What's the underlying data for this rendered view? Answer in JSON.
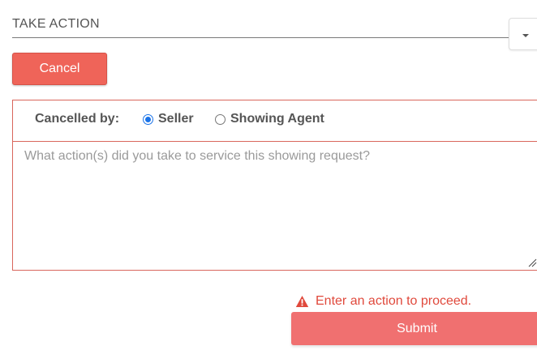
{
  "section": {
    "title": "TAKE ACTION"
  },
  "dropdown": {
    "icon": "caret-down-icon"
  },
  "buttons": {
    "cancel": "Cancel",
    "submit": "Submit"
  },
  "cancelled_by": {
    "label": "Cancelled by:",
    "options": [
      {
        "label": "Seller",
        "selected": true
      },
      {
        "label": "Showing Agent",
        "selected": false
      }
    ]
  },
  "action_field": {
    "value": "",
    "placeholder": "What action(s) did you take to service this showing request?"
  },
  "validation": {
    "icon": "warning-icon",
    "message": "Enter an action to proceed."
  },
  "colors": {
    "accent": "#ef6459",
    "submit": "#f07070",
    "error": "#e0493c",
    "radio_selected": "#1a73e8"
  }
}
